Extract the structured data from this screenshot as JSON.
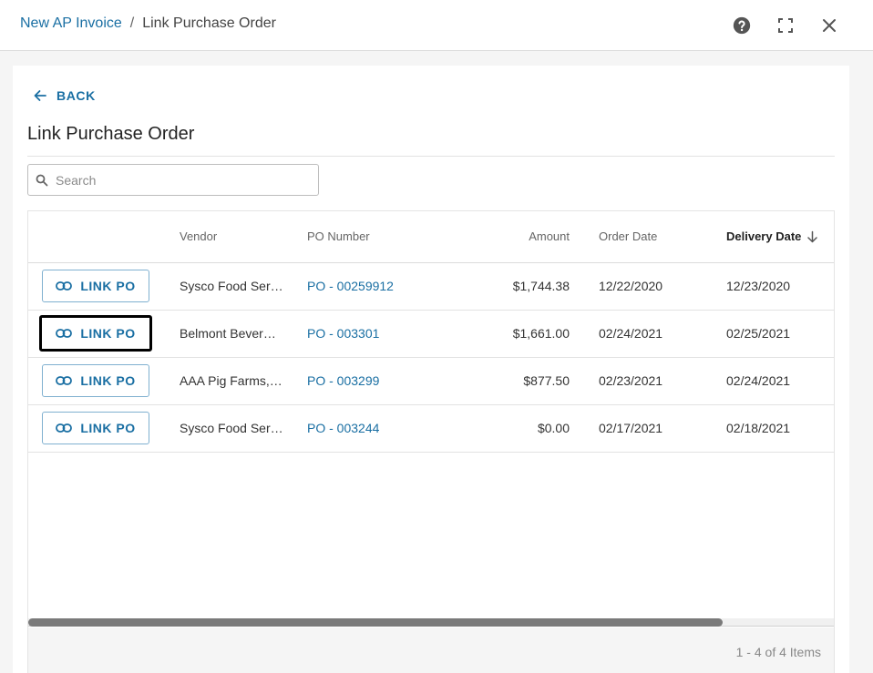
{
  "breadcrumb": {
    "parent": "New AP Invoice",
    "separator": "/",
    "current": "Link Purchase Order"
  },
  "header_icons": [
    "help-icon",
    "fullscreen-icon",
    "close-icon"
  ],
  "back_label": "BACK",
  "page_title": "Link Purchase Order",
  "search": {
    "placeholder": "Search",
    "value": ""
  },
  "table": {
    "columns": [
      "",
      "Vendor",
      "PO Number",
      "Amount",
      "Order Date",
      "Delivery Date"
    ],
    "sorted_column": "Delivery Date",
    "sort_direction": "descending",
    "rows": [
      {
        "action": "LINK PO",
        "vendor": "Sysco Food Ser…",
        "po": "PO - 00259912",
        "amount": "$1,744.38",
        "order_date": "12/22/2020",
        "delivery_date": "12/23/2020",
        "focused": false
      },
      {
        "action": "LINK PO",
        "vendor": "Belmont Bever…",
        "po": "PO - 003301",
        "amount": "$1,661.00",
        "order_date": "02/24/2021",
        "delivery_date": "02/25/2021",
        "focused": true
      },
      {
        "action": "LINK PO",
        "vendor": "AAA Pig Farms,…",
        "po": "PO - 003299",
        "amount": "$877.50",
        "order_date": "02/23/2021",
        "delivery_date": "02/24/2021",
        "focused": false
      },
      {
        "action": "LINK PO",
        "vendor": "Sysco Food Ser…",
        "po": "PO - 003244",
        "amount": "$0.00",
        "order_date": "02/17/2021",
        "delivery_date": "02/18/2021",
        "focused": false
      }
    ]
  },
  "pager_text": "1 - 4 of 4 Items",
  "colors": {
    "accent": "#1a6fa3",
    "button_border": "#7fb0d0",
    "focus_ring": "#000000"
  }
}
